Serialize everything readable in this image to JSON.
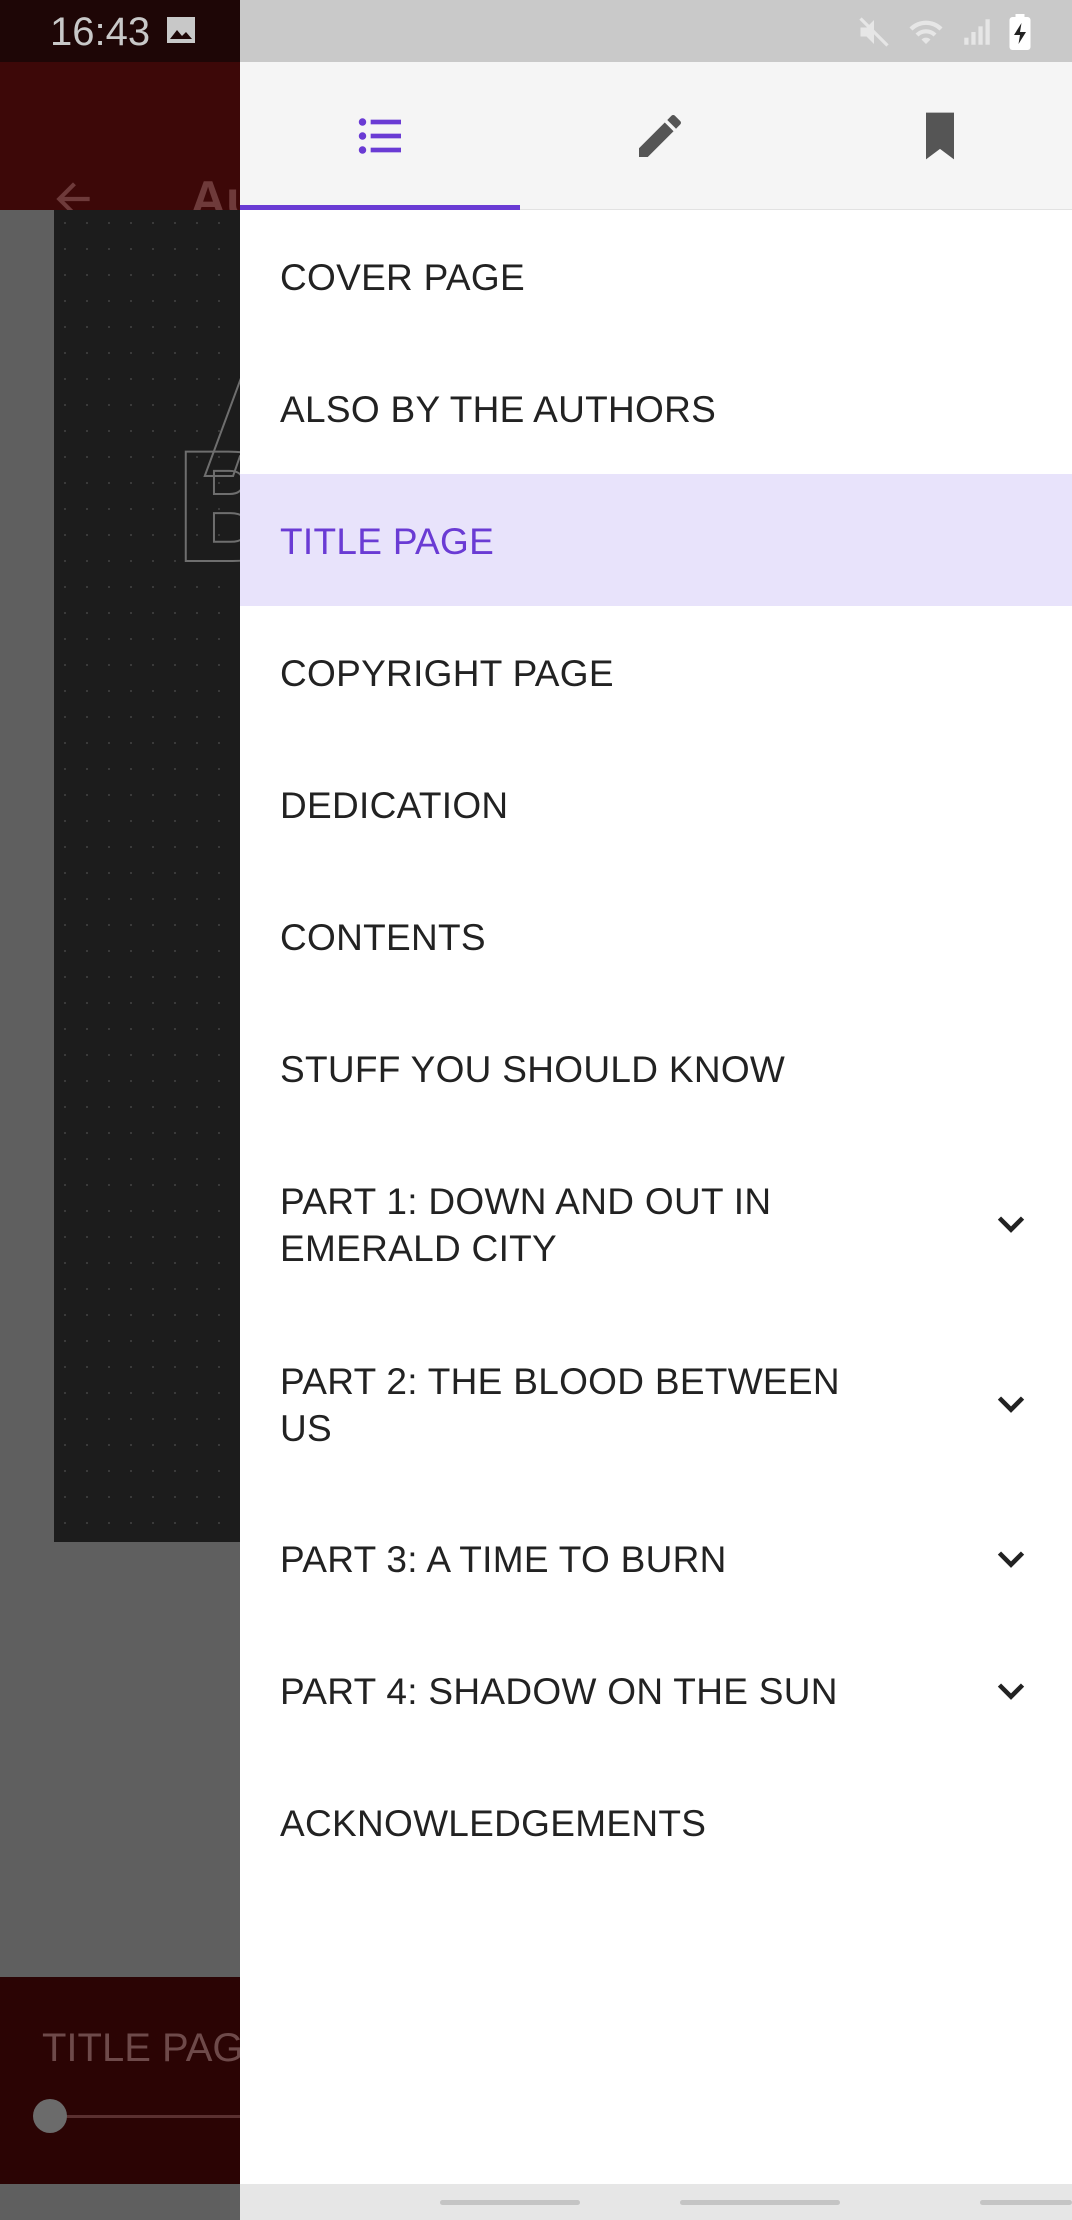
{
  "status_bar": {
    "time": "16:43"
  },
  "background_app": {
    "title": "Au",
    "bottom_label": "TITLE PAG",
    "cover_letters": [
      "A",
      "B"
    ]
  },
  "drawer": {
    "tabs": [
      {
        "id": "contents",
        "icon": "list-icon",
        "selected": true
      },
      {
        "id": "notes",
        "icon": "pencil-icon",
        "selected": false
      },
      {
        "id": "bookmarks",
        "icon": "bookmark-icon",
        "selected": false
      }
    ],
    "toc": [
      {
        "label": "COVER PAGE",
        "expandable": false
      },
      {
        "label": "ALSO BY THE AUTHORS",
        "expandable": false
      },
      {
        "label": "TITLE PAGE",
        "expandable": false,
        "active": true
      },
      {
        "label": "COPYRIGHT PAGE",
        "expandable": false
      },
      {
        "label": "DEDICATION",
        "expandable": false
      },
      {
        "label": "CONTENTS",
        "expandable": false
      },
      {
        "label": "STUFF YOU SHOULD KNOW",
        "expandable": false
      },
      {
        "label": "PART 1: DOWN AND OUT IN EMERALD CITY",
        "expandable": true
      },
      {
        "label": "PART 2: THE BLOOD BETWEEN US",
        "expandable": true
      },
      {
        "label": "PART 3: A TIME TO BURN",
        "expandable": true
      },
      {
        "label": "PART 4: SHADOW ON THE SUN",
        "expandable": true
      },
      {
        "label": "ACKNOWLEDGEMENTS",
        "expandable": false
      }
    ]
  },
  "colors": {
    "accent": "#6a3bd4",
    "active_row_bg": "#e8e3fb",
    "text": "#222222"
  }
}
